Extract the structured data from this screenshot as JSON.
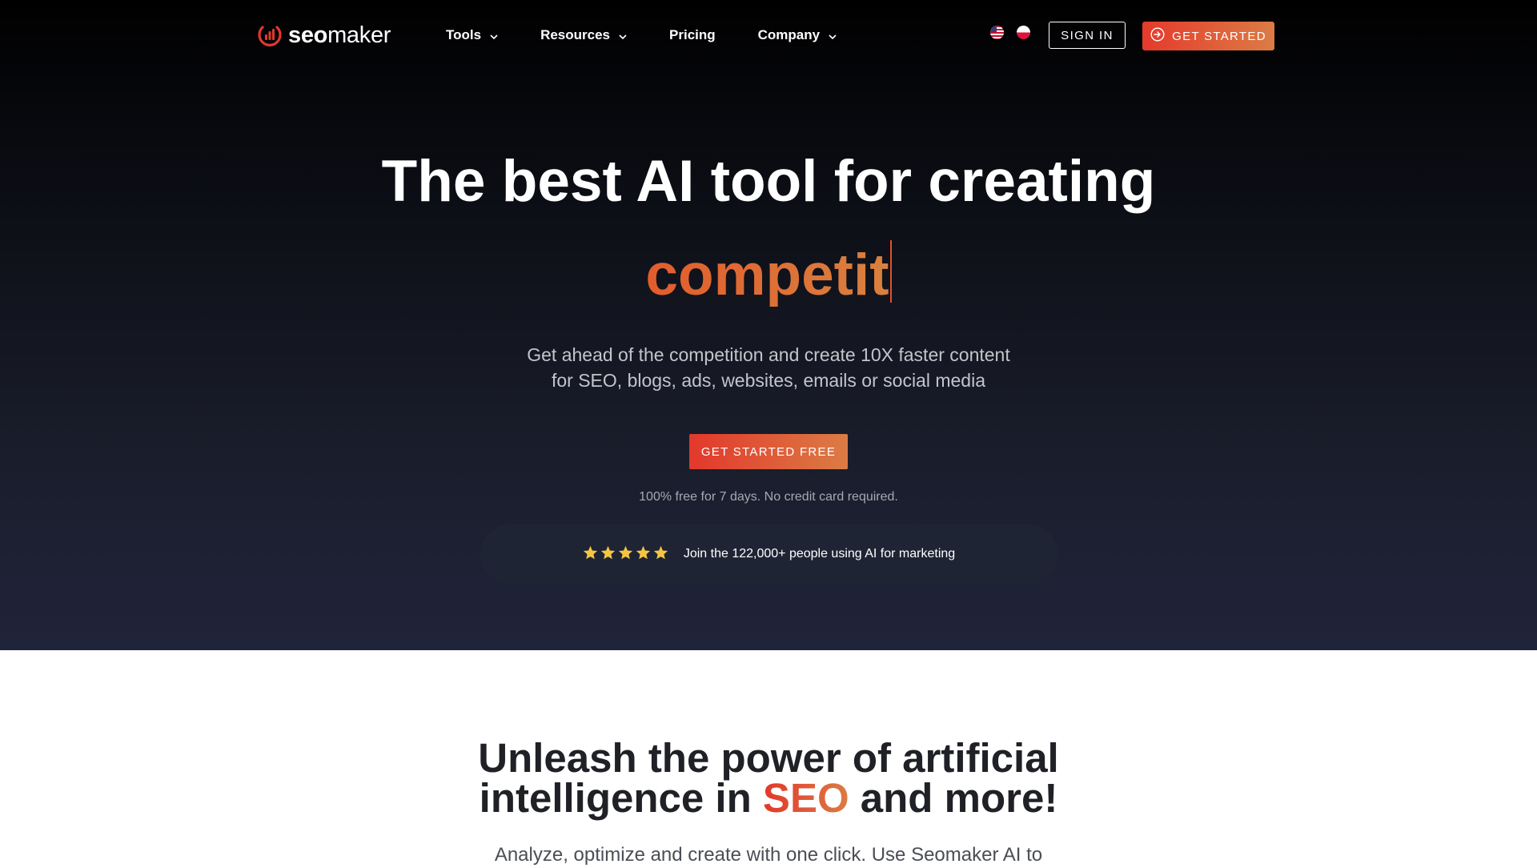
{
  "brand": {
    "logo_bold": "seo",
    "logo_light": "maker",
    "accent": "#e2382b",
    "accent_end": "#db7c45"
  },
  "nav": {
    "items": [
      {
        "label": "Tools",
        "has_dropdown": true
      },
      {
        "label": "Resources",
        "has_dropdown": true
      },
      {
        "label": "Pricing",
        "has_dropdown": false
      },
      {
        "label": "Company",
        "has_dropdown": true
      }
    ],
    "languages": [
      "us-flag-icon",
      "pl-flag-icon"
    ],
    "sign_in": "SIGN IN",
    "get_started": "GET STARTED"
  },
  "hero": {
    "headline": "The best AI tool for creating",
    "typed_word": "competit",
    "subtext_line1": "Get ahead of the competition and create 10X faster content",
    "subtext_line2": "for SEO, blogs, ads, websites, emails or social media",
    "cta": "GET STARTED FREE",
    "free_note": "100% free for 7 days. No credit card required.",
    "rating_stars": 5,
    "social_proof": "Join the 122,000+ people using AI for marketing"
  },
  "section2": {
    "title_line1": "Unleash the power of artificial",
    "title_line2_pre": "intelligence in ",
    "title_highlight": "SEO",
    "title_line2_post": " and more!",
    "subtext": "Analyze, optimize and create with one click. Use Seomaker AI to"
  }
}
